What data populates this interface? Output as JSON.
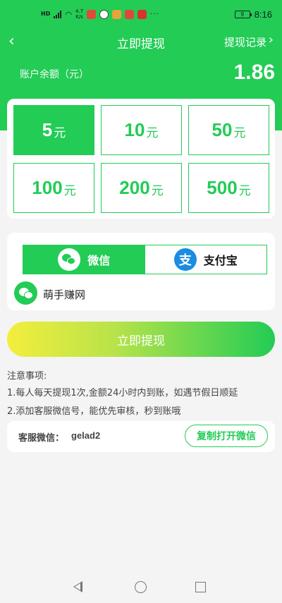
{
  "status_bar": {
    "network_badge": "HD",
    "speed_value": "4.7",
    "speed_unit": "K/s",
    "more_dots": "···",
    "battery": "9",
    "time": "8:16"
  },
  "header": {
    "title": "立即提现",
    "records_label": "提现记录",
    "balance_label": "账户余额（元）",
    "balance_value": "1.86"
  },
  "amounts": {
    "unit": "元",
    "selected_index": 0,
    "options": [
      "5",
      "10",
      "50",
      "100",
      "200",
      "500"
    ]
  },
  "payment": {
    "tabs": [
      {
        "label": "微信",
        "icon": "wechat-icon"
      },
      {
        "label": "支付宝",
        "icon": "alipay-icon",
        "glyph": "支"
      }
    ],
    "account_name": "萌手赚网"
  },
  "withdraw_button": "立即提现",
  "notes": {
    "title": "注意事项:",
    "items": [
      "1.每人每天提现1次,金额24小时内到账，如遇节假日顺延",
      "2.添加客服微信号，能优先审核，秒到账哦"
    ]
  },
  "service": {
    "label": "客服微信：",
    "wechat_id": "gelad2",
    "copy_button": "复制打开微信"
  },
  "colors": {
    "primary": "#22cc55",
    "alipay_blue": "#1a8de0",
    "gradient_start": "#f3ee3c"
  }
}
